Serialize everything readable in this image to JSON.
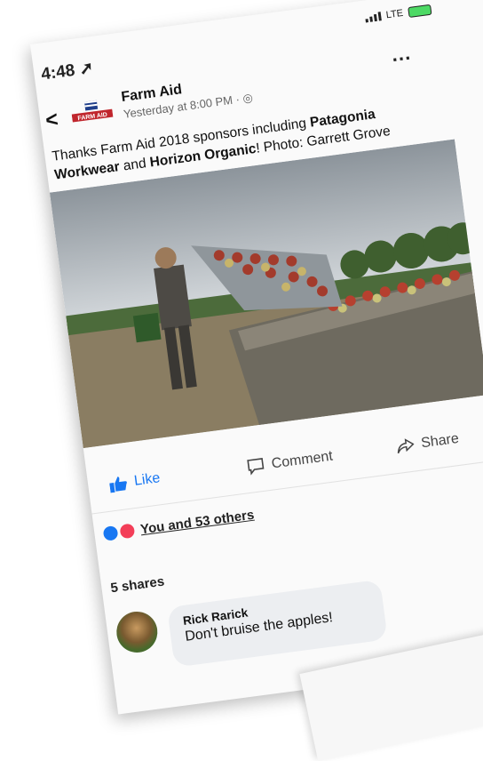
{
  "status": {
    "time": "4:48",
    "network": "LTE"
  },
  "post": {
    "page_name": "Farm Aid",
    "timestamp": "Yesterday at 8:00 PM ·",
    "caption_part1": "Thanks Farm Aid 2018 sponsors including ",
    "caption_bold1": "Patagonia Workwear",
    "caption_part2": " and ",
    "caption_bold2": "Horizon Organic",
    "caption_part3": "! Photo: Garrett Grove",
    "logo_text": "FARM AID"
  },
  "actions": {
    "like": "Like",
    "comment": "Comment",
    "share": "Share"
  },
  "reactions": {
    "text": "You and 53 others"
  },
  "shares": "5 shares",
  "comment": {
    "author": "Rick Rarick",
    "text": "Don't bruise the apples!"
  },
  "colors": {
    "accent": "#1877f2",
    "love": "#f33e58"
  }
}
